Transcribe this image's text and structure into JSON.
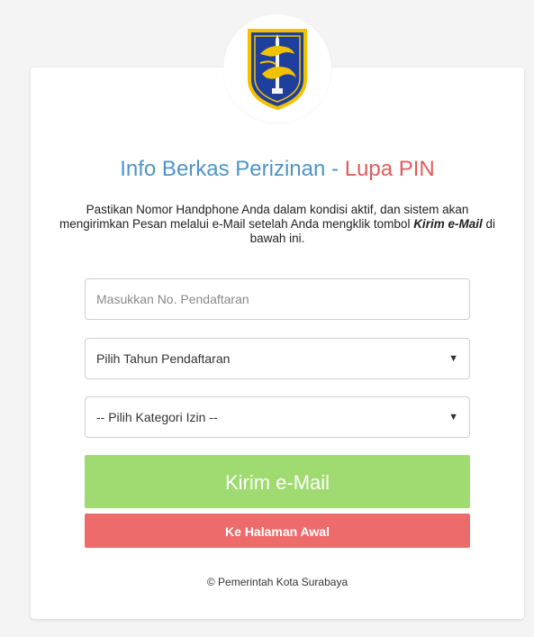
{
  "header": {
    "logo_icon": "surabaya-crest-icon",
    "title_main": "Info Berkas Perizinan",
    "title_separator": " - ",
    "title_accent": "Lupa PIN"
  },
  "instructions": {
    "text_before": "Pastikan Nomor Handphone Anda dalam kondisi aktif, dan sistem akan mengirimkan Pesan melalui e-Mail setelah Anda mengklik tombol ",
    "emphasis": "Kirim e-Mail",
    "text_after": " di bawah ini."
  },
  "form": {
    "registration_number": {
      "placeholder": "Masukkan No. Pendaftaran",
      "value": ""
    },
    "year_select": {
      "selected": "Pilih Tahun Pendaftaran"
    },
    "category_select": {
      "selected": "-- Pilih Kategori Izin --"
    },
    "send_button": "Kirim e-Mail",
    "home_button": "Ke Halaman Awal"
  },
  "footer": {
    "copyright": "© Pemerintah Kota Surabaya"
  },
  "colors": {
    "title": "#4f94c5",
    "accent": "#e35b5b",
    "send_button": "#9fdb70",
    "home_button": "#ee6b6b"
  }
}
